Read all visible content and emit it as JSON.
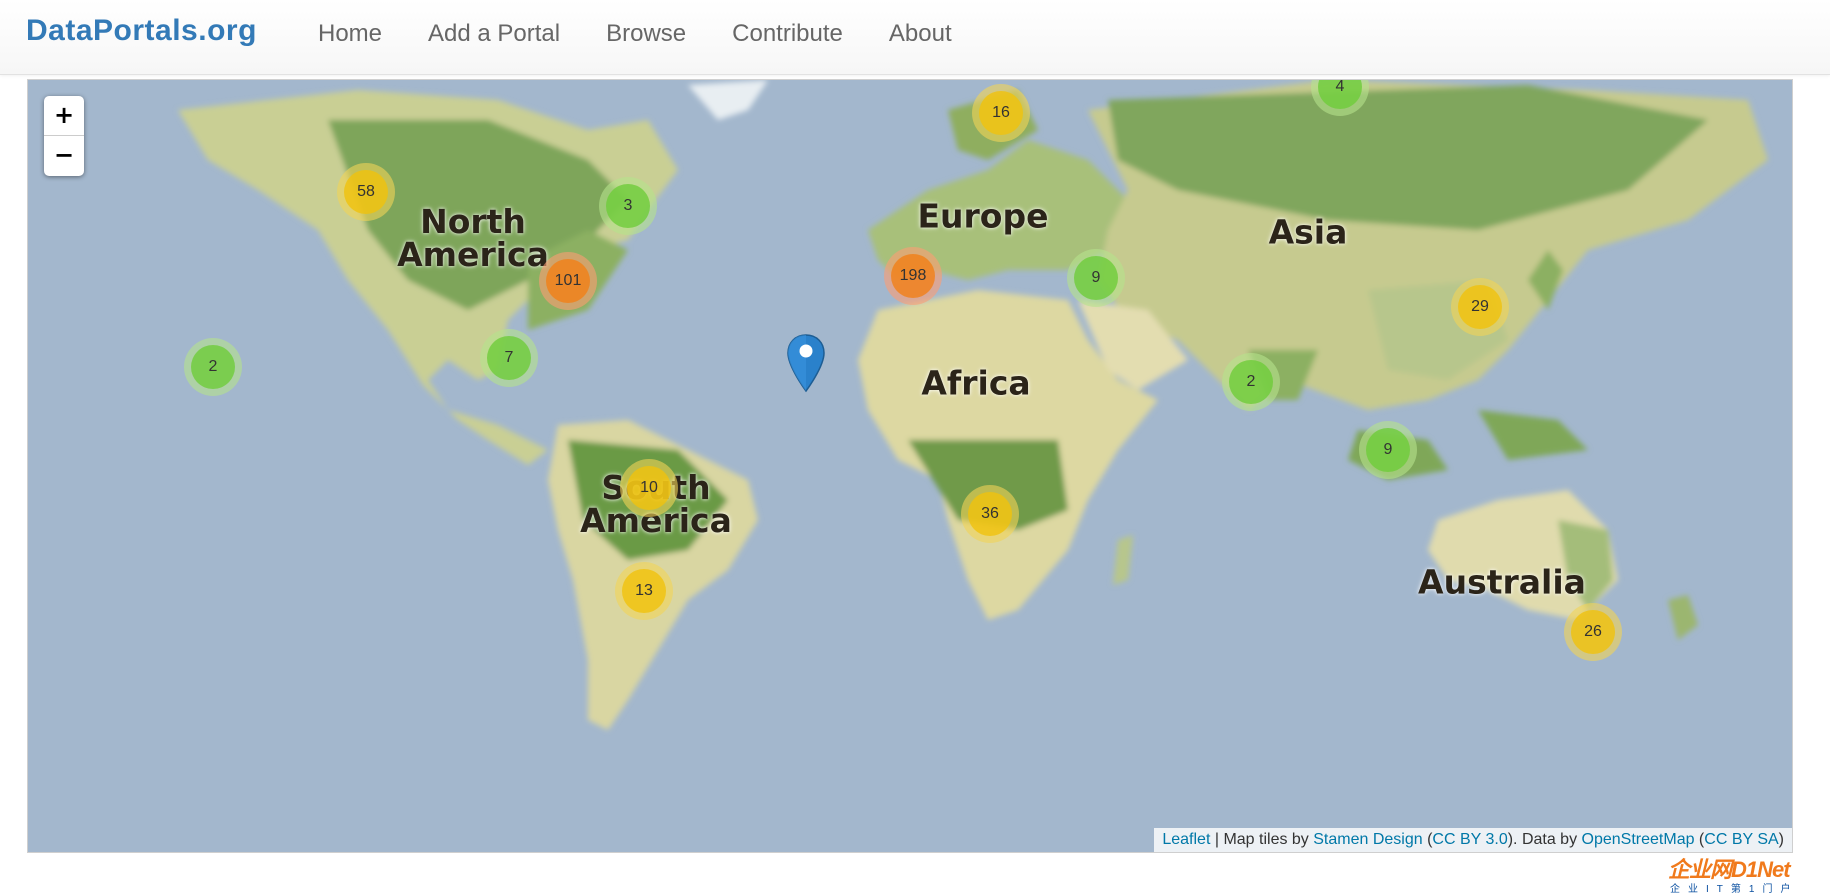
{
  "navbar": {
    "brand": "DataPortals.org",
    "links": [
      "Home",
      "Add a Portal",
      "Browse",
      "Contribute",
      "About"
    ]
  },
  "map": {
    "zoom_in": "+",
    "zoom_out": "−",
    "continents": [
      {
        "id": "north-america",
        "label": "North\nAmerica"
      },
      {
        "id": "south-america",
        "label": "South\nAmerica"
      },
      {
        "id": "europe",
        "label": "Europe"
      },
      {
        "id": "asia",
        "label": "Asia"
      },
      {
        "id": "africa",
        "label": "Africa"
      },
      {
        "id": "australia",
        "label": "Australia"
      }
    ],
    "clusters": [
      {
        "count": "58",
        "size": "medium"
      },
      {
        "count": "3",
        "size": "small"
      },
      {
        "count": "101",
        "size": "large"
      },
      {
        "count": "7",
        "size": "small"
      },
      {
        "count": "2",
        "size": "small"
      },
      {
        "count": "10",
        "size": "medium"
      },
      {
        "count": "13",
        "size": "medium"
      },
      {
        "count": "16",
        "size": "medium"
      },
      {
        "count": "4",
        "size": "small"
      },
      {
        "count": "198",
        "size": "large"
      },
      {
        "count": "9",
        "size": "small"
      },
      {
        "count": "29",
        "size": "medium"
      },
      {
        "count": "2",
        "size": "small"
      },
      {
        "count": "9",
        "size": "small"
      },
      {
        "count": "36",
        "size": "medium"
      },
      {
        "count": "26",
        "size": "medium"
      }
    ],
    "attribution": {
      "leaflet": "Leaflet",
      "sep1": " | Map tiles by ",
      "stamen": "Stamen Design",
      "open1": " (",
      "cc_by": "CC BY 3.0",
      "mid": "). Data by ",
      "osm": "OpenStreetMap",
      "open2": " (",
      "cc_by_sa": "CC BY SA",
      "close": ")"
    }
  },
  "watermark": {
    "logo": "企业网D1Net",
    "tagline": "企业IT第1门户"
  },
  "colors": {
    "brand": "#337ab7",
    "ocean": "#a3b7cd",
    "land_green": "#8fae5f",
    "land_sand": "#e6dfb0",
    "cluster_small": "#6ecc39",
    "cluster_medium": "#f0c20c",
    "cluster_large": "#f18017",
    "marker": "#2a81cb"
  }
}
